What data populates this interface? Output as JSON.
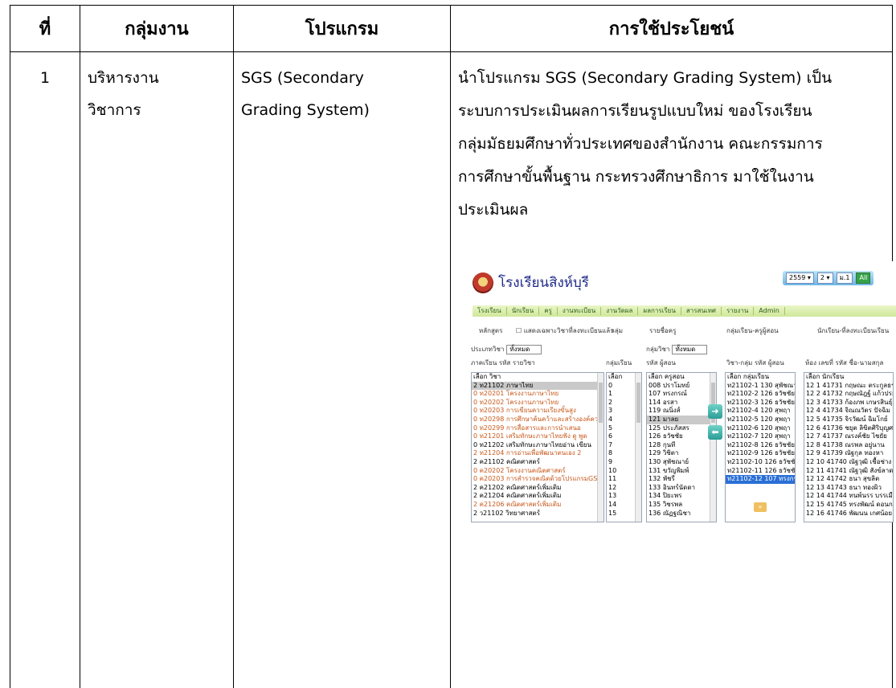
{
  "table": {
    "headers": [
      "ที่",
      "กลุ่มงาน",
      "โปรแกรม",
      "การใช้ประโยชน์"
    ],
    "row": {
      "no": "1",
      "group_line1": "บริหารงาน",
      "group_line2": "วิชาการ",
      "program_line1": "SGS (Secondary",
      "program_line2": "Grading System)",
      "usage_lines": [
        "นำโปรแกรม SGS (Secondary Grading System) เป็น",
        "ระบบการประเมินผลการเรียนรูปแบบใหม่ ของโรงเรียน",
        "กลุ่มมัธยมศึกษาทั่วประเทศของสำนักงาน คณะกรรมการ",
        "การศึกษาขั้นพื้นฐาน กระทรวงศึกษาธิการ มาใช้ในงาน",
        "ประเมินผล"
      ]
    }
  },
  "screenshot": {
    "school_name": "โรงเรียนสิงห์บุรี",
    "controls": {
      "year": "2559 ▾",
      "term": "2 ▾",
      "level": "ม.1",
      "all": "All"
    },
    "nav": [
      "โรงเรียน",
      "นักเรียน",
      "ครู",
      "งานทะเบียน",
      "งานวัดผล",
      "ผลการเรียน",
      "สารสนเทศ",
      "รายงาน",
      "Admin"
    ],
    "col1": {
      "heading": "หลักสูตร",
      "checkbox_label": "แสดงเฉพาะวิชาที่ลงทะเบียนแล้ว",
      "filter_label": "ประเภทวิชา",
      "filter_value": "ทั้งหมด",
      "subhead": "ภาคเรียน รหัส รายวิชา"
    },
    "col2": {
      "heading": "กลุ่ม",
      "subhead": "กลุ่มเรียน"
    },
    "col3": {
      "heading": "รายชื่อครู",
      "filter_label": "กลุ่มวิชา",
      "filter_value": "ทั้งหมด",
      "subhead": "รหัส ผู้สอน"
    },
    "col4": {
      "heading": "กลุ่มเรียน-ครูผู้สอน",
      "subhead": "วิชา-กลุ่ม รหัส ผู้สอน"
    },
    "col5": {
      "heading": "นักเรียน-ที่ลงทะเบียนเรียน",
      "subhead": "ห้อง เลขที่ รหัส ชื่อ-นามสกุล"
    },
    "subjects": [
      {
        "t": "เลือก วิชา",
        "c": ""
      },
      {
        "t": "2 ท21102 ภาษาไทย",
        "c": "sel"
      },
      {
        "t": "0 ท20201 โครงงานภาษาไทย",
        "c": "orange"
      },
      {
        "t": "0 ท20202 โครงงานภาษาไทย",
        "c": "orange"
      },
      {
        "t": "0 ท20203 การเขียนความเรียงขั้นสูง",
        "c": "orange"
      },
      {
        "t": "0 ท20298 การศึกษาค้นคว้าและสร้างองค์ความรู้",
        "c": "orange"
      },
      {
        "t": "0 ท20299 การสื่อสารและการนำเสนอ",
        "c": "orange"
      },
      {
        "t": "0 ท21201 เสริมทักษะภาษาไทยฟัง ดู พูด",
        "c": "orange"
      },
      {
        "t": "0 ท21202 เสริมทักษะภาษาไทยอ่าน เขียน",
        "c": ""
      },
      {
        "t": "2 ท21204 การอ่านเพื่อพัฒนาตนเอง 2",
        "c": "orange"
      },
      {
        "t": "2 ค21102 คณิตศาสตร์",
        "c": ""
      },
      {
        "t": "0 ค20202 โครงงานคณิตศาสตร์",
        "c": "orange"
      },
      {
        "t": "0 ค20203 การสำรวจคณิตด้วยโปรแกรมGSP",
        "c": "orange"
      },
      {
        "t": "2 ค21202 คณิตศาสตร์เพิ่มเติม",
        "c": ""
      },
      {
        "t": "2 ค21204 คณิตศาสตร์เพิ่มเติม",
        "c": ""
      },
      {
        "t": "2 ค21206 คณิตศาสตร์เพิ่มเติม",
        "c": "orange"
      },
      {
        "t": "2 ว21102 วิทยาศาสตร์",
        "c": ""
      }
    ],
    "groups": [
      "เลือก",
      "0",
      "1",
      "2",
      "3",
      "4",
      "5",
      "6",
      "7",
      "8",
      "9",
      "10",
      "11",
      "12",
      "13",
      "14",
      "15"
    ],
    "teachers": [
      {
        "t": "เลือก ครูสอน",
        "c": ""
      },
      {
        "t": "008 ปราโมทย์",
        "c": ""
      },
      {
        "t": "107 ทรงกรณ์",
        "c": ""
      },
      {
        "t": "114 อรสา",
        "c": ""
      },
      {
        "t": "119 ณนิ่งส์",
        "c": ""
      },
      {
        "t": "121 มาลย",
        "c": "sel"
      },
      {
        "t": "125 ประภัสสร",
        "c": ""
      },
      {
        "t": "126 ธวัชชัย",
        "c": ""
      },
      {
        "t": "128 กุนที",
        "c": ""
      },
      {
        "t": "129 วิชิตา",
        "c": ""
      },
      {
        "t": "130 สุพัชณาย์",
        "c": ""
      },
      {
        "t": "131 ขวัญพิมพ์",
        "c": ""
      },
      {
        "t": "132 พัชรี",
        "c": ""
      },
      {
        "t": "133 อินทร์นัดดา",
        "c": ""
      },
      {
        "t": "134 ปิยะพร",
        "c": ""
      },
      {
        "t": "135 วิชรพล",
        "c": ""
      },
      {
        "t": "136 ณัฏฐณิชา",
        "c": ""
      }
    ],
    "assignments": [
      {
        "t": "เลือก กลุ่มเรียน",
        "c": ""
      },
      {
        "t": "ท21102-1 130 สุพัชณาย์",
        "c": ""
      },
      {
        "t": "ท21102-2 126 ธวัชชัย",
        "c": ""
      },
      {
        "t": "ท21102-3 126 ธวัชชัย",
        "c": ""
      },
      {
        "t": "ท21102-4 120 สุพฤา",
        "c": ""
      },
      {
        "t": "ท21102-5 120 สุพฤา",
        "c": ""
      },
      {
        "t": "ท21102-6 120 สุพฤา",
        "c": ""
      },
      {
        "t": "ท21102-7 120 สุพฤา",
        "c": ""
      },
      {
        "t": "ท21102-8 126 ธวัชชัย",
        "c": ""
      },
      {
        "t": "ท21102-9 126 ธวัชชัย",
        "c": ""
      },
      {
        "t": "ท21102-10 126 ธวัชชัย",
        "c": ""
      },
      {
        "t": "ท21102-11 126 ธวัชชัย",
        "c": ""
      },
      {
        "t": "ท21102-12 107 ทรงกรณ์",
        "c": "blue"
      }
    ],
    "students": [
      {
        "t": "เลือก นักเรียน",
        "c": ""
      },
      {
        "t": "12 1 41731 กฤษณะ ตระกูลธร",
        "c": ""
      },
      {
        "t": "12 2 41732 กฤษณัฎฐ์ แก้วประเสริฐ",
        "c": ""
      },
      {
        "t": "12 3 41733 ก้องภพ เกษรสินธุ์",
        "c": ""
      },
      {
        "t": "12 4 41734 จิณณวัตร ปัจฉิม",
        "c": ""
      },
      {
        "t": "12 5 41735 จิรวัฒน์ ฉิมโกย์",
        "c": ""
      },
      {
        "t": "12 6 41736 ชยุต ลิขิตศิริบุญศรณ์",
        "c": ""
      },
      {
        "t": "12 7 41737 ณรงค์ชัย ไชยัย",
        "c": ""
      },
      {
        "t": "12 8 41738 ณรพล อยู่นาน",
        "c": ""
      },
      {
        "t": "12 9 41739 ณัฐกุล ทองหา",
        "c": ""
      },
      {
        "t": "12 10 41740 ณัฐวุฒิ เชื้อช่าง",
        "c": ""
      },
      {
        "t": "12 11 41741 ณัฐวุฒิ สังข์ลาด",
        "c": ""
      },
      {
        "t": "12 12 41742 ธนา สุขลิต",
        "c": ""
      },
      {
        "t": "12 13 41743 ธนา ทองผิว",
        "c": ""
      },
      {
        "t": "12 14 41744 ทนพ์นรร บรรเมือง",
        "c": ""
      },
      {
        "t": "12 15 41745 ทรงพัฒน์ ดอนกล้ำ",
        "c": ""
      },
      {
        "t": "12 16 41746 พัฒนน เกศน้อย",
        "c": ""
      }
    ],
    "btn_add": "➜",
    "btn_remove": "⬅"
  }
}
